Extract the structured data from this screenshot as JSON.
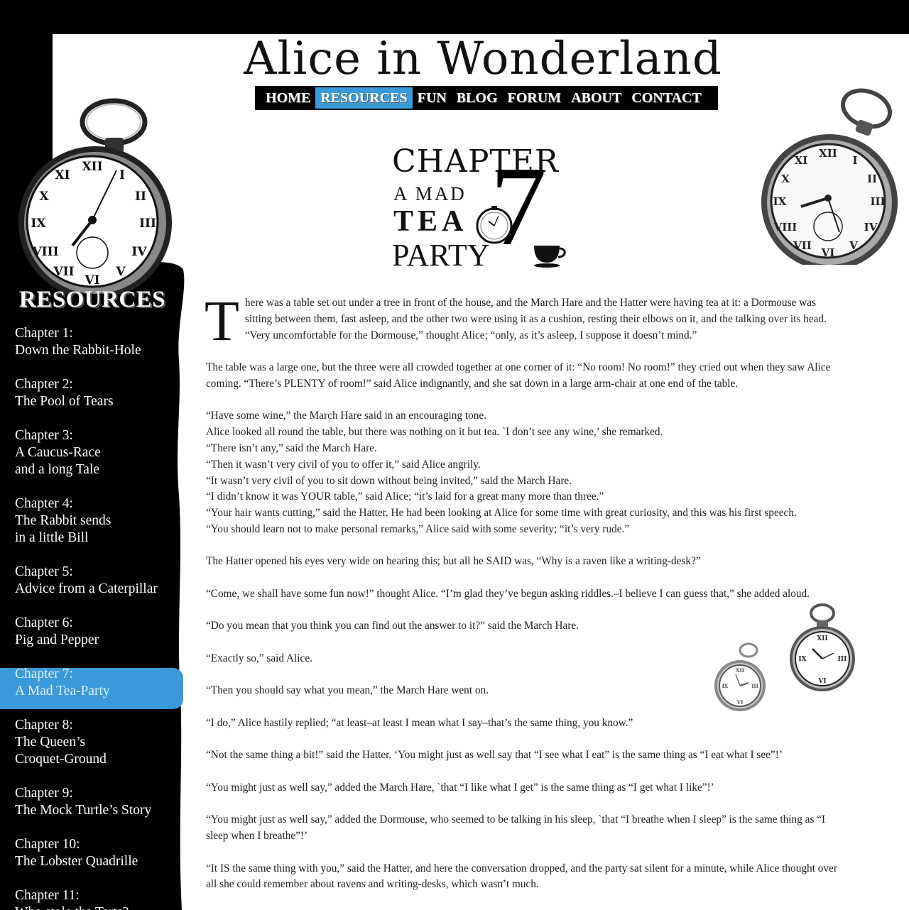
{
  "site": {
    "title": "Alice in Wonderland"
  },
  "nav": {
    "items": [
      {
        "label": "HOME",
        "active": false
      },
      {
        "label": "RESOURCES",
        "active": true
      },
      {
        "label": "FUN",
        "active": false
      },
      {
        "label": "BLOG",
        "active": false
      },
      {
        "label": "FORUM",
        "active": false
      },
      {
        "label": "ABOUT",
        "active": false
      },
      {
        "label": "CONTACT",
        "active": false
      }
    ]
  },
  "sidebar": {
    "heading": "RESOURCES",
    "chapters": [
      {
        "number": "Chapter 1:",
        "title_lines": [
          "Down the Rabbit-Hole"
        ]
      },
      {
        "number": "Chapter 2:",
        "title_lines": [
          "The Pool of Tears"
        ]
      },
      {
        "number": "Chapter 3:",
        "title_lines": [
          "A Caucus-Race",
          "and a long Tale"
        ]
      },
      {
        "number": "Chapter 4:",
        "title_lines": [
          "The Rabbit sends",
          "in a little Bill"
        ]
      },
      {
        "number": "Chapter 5:",
        "title_lines": [
          "Advice from a Caterpillar"
        ]
      },
      {
        "number": "Chapter 6:",
        "title_lines": [
          "Pig and Pepper"
        ]
      },
      {
        "number": "Chapter 7:",
        "title_lines": [
          "A Mad Tea-Party"
        ],
        "active": true
      },
      {
        "number": "Chapter 8:",
        "title_lines": [
          "The Queen’s",
          "Croquet-Ground"
        ]
      },
      {
        "number": "Chapter 9:",
        "title_lines": [
          "The Mock Turtle’s Story"
        ]
      },
      {
        "number": "Chapter 10:",
        "title_lines": [
          "The Lobster Quadrille"
        ]
      },
      {
        "number": "Chapter 11:",
        "title_lines": [
          "Who stole the Tarts?"
        ]
      }
    ]
  },
  "chapter_logo": {
    "word": "CHAPTER",
    "line1": "A MAD",
    "line2": "TEA",
    "line3": "PARTY",
    "number": "7"
  },
  "article": {
    "dropcap": "T",
    "first_paragraph": "here was a table set out under a tree in front of the house, and the March Hare and the Hatter were having tea at it: a Dormouse was sitting between them, fast asleep, and the other two were using it as a cushion, resting their elbows on it, and the talking over its head. “Very uncomfortable for the Dormouse,” thought Alice; “only, as it’s asleep, I suppose it doesn’t mind.”",
    "p2": "The table was a large one, but the three were all crowded together at one corner of it: “No room! No room!” they cried out when they saw Alice coming. “There’s PLENTY of room!” said Alice indignantly, and she sat down in a large arm-chair at one end of the table.",
    "dialogue": [
      "“Have some wine,” the March Hare said in an encouraging tone.",
      "Alice looked all round the table, but there was nothing on it but tea. `I don’t see any wine,’ she remarked.",
      "“There isn’t any,” said the March Hare.",
      "“Then it wasn’t very civil of you to offer it,” said Alice angrily.",
      "“It wasn’t very civil of you to sit down without being invited,” said the March Hare.",
      "“I didn’t know it was YOUR table,” said Alice; “it’s laid for a great many more than three.”",
      "“Your hair wants cutting,” said the Hatter. He had been looking at Alice for some time with great curiosity, and this was his first speech.",
      "“You should learn not to make personal remarks,” Alice said with some severity; “it’s very rude.”"
    ],
    "p3": "The Hatter opened his eyes very wide on hearing this; but all he SAID was, “Why is a raven like a writing-desk?”",
    "p4": "“Come, we shall have some fun now!” thought Alice. “I’m glad they’ve begun asking riddles.–I believe I can guess that,” she added aloud.",
    "p5": "“Do you mean that you think you can find out the answer to it?” said the March Hare.",
    "p6": "“Exactly so,” said Alice.",
    "p7": "“Then you should say what you mean,” the March Hare went on.",
    "p8": "“I do,” Alice hastily replied; “at least–at least I mean what I say–that’s the same thing, you know.”",
    "p9": "“Not the same thing a bit!” said the Hatter. ‘You might just as well say that “I see what I eat” is the same thing as “I eat what I see”!’",
    "p10": "“You might just as well say,” added the March Hare, `that “I like what I get” is the same thing as “I get what I like”!’",
    "p11": "“You might just as well say,” added the Dormouse, who seemed to be talking in his sleep, `that “I breathe when I sleep” is the same thing as “I sleep when I breathe”!’",
    "p12": "“It IS the same thing with you,” said the Hatter, and here the conversation dropped, and the party sat silent for a minute, while Alice thought over all she could remember about ravens and writing-desks, which wasn’t much."
  },
  "colors": {
    "accent": "#3a9ad9",
    "background": "#000000",
    "content": "#ffffff"
  },
  "icons": [
    "pocket-watch-icon",
    "teacup-icon"
  ]
}
